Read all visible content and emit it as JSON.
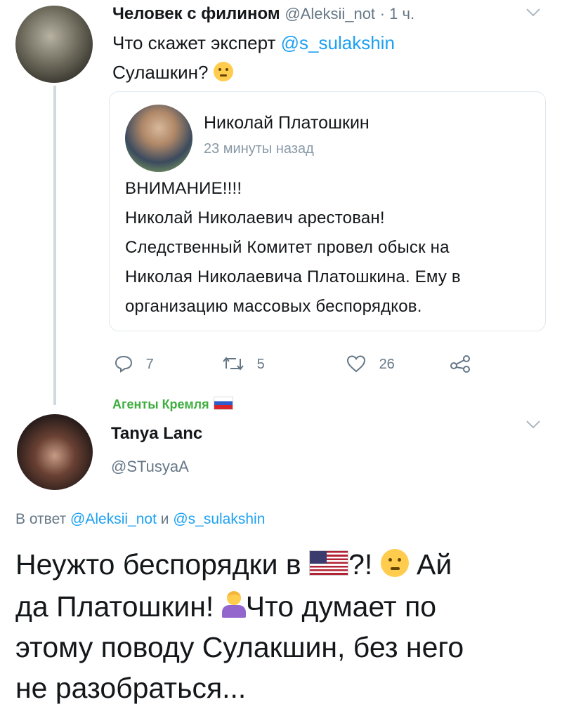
{
  "tweet1": {
    "author_name": "Человек с филином",
    "handle": "@Aleksii_not",
    "time": "· 1 ч.",
    "text_prefix": "Что скажет эксперт ",
    "text_mention": "@s_sulakshin",
    "text_line2": "Сулашкин?",
    "emoji": "thinking-face"
  },
  "quote": {
    "author_name": "Николай Платошкин",
    "time": "23 минуты назад",
    "lines": [
      "ВНИМАНИЕ!!!!",
      "Николай Николаевич арестован!",
      "Следственный Комитет провел обыск на",
      "Николая Николаевича Платошкина. Ему в",
      "организацию массовых беспорядков."
    ]
  },
  "actions": {
    "reply_count": "7",
    "retweet_count": "5",
    "like_count": "26"
  },
  "tweet2": {
    "group_label": "Агенты Кремля",
    "author_name": "Tanya Lanc",
    "handle": "@STusyaA",
    "reply_prefix": "В ответ ",
    "reply_mention1": "@Aleksii_not",
    "reply_and": " и ",
    "reply_mention2": "@s_sulakshin",
    "text_line1_a": "Неужто беспорядки в ",
    "text_line1_b": "?! ",
    "text_line1_c": " Ай",
    "text_line2_a": "да Платошкин! ",
    "text_line2_b": "Что думает по",
    "text_line3": "этому поводу Сулакшин, без него",
    "text_line4": "не разобраться..."
  },
  "icons": [
    "reply-icon",
    "retweet-icon",
    "like-icon",
    "share-icon",
    "chevron-down-icon"
  ],
  "colors": {
    "link": "#1da1f2",
    "muted": "#657786",
    "group_label": "#3fae3f"
  }
}
